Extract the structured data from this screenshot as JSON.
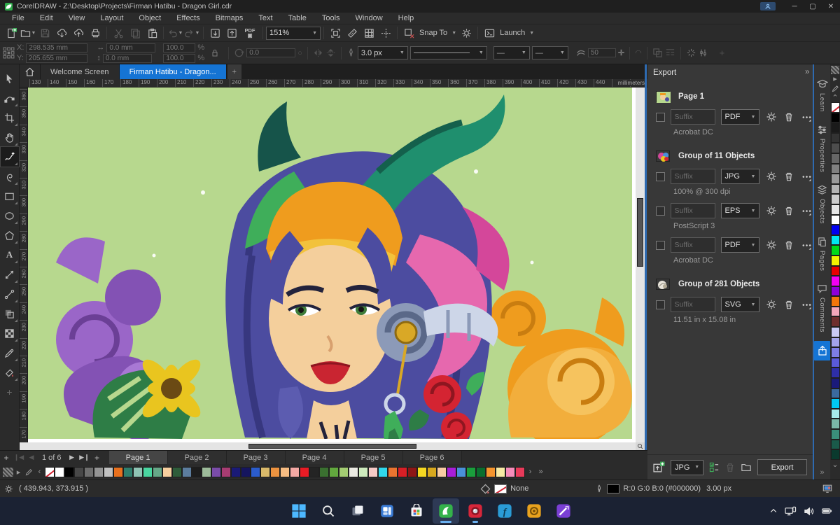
{
  "accent": "#1574d4",
  "titlebar": {
    "title": "CorelDRAW - Z:\\Desktop\\Projects\\Firman Hatibu - Dragon Girl.cdr"
  },
  "menubar": {
    "items": [
      "File",
      "Edit",
      "View",
      "Layout",
      "Object",
      "Effects",
      "Bitmaps",
      "Text",
      "Table",
      "Tools",
      "Window",
      "Help"
    ]
  },
  "toolbar": {
    "zoom_value": "151%",
    "snap_label": "Snap To",
    "launch_label": "Launch",
    "pdf_label": "PDF",
    "buttons": [
      {
        "name": "new-document",
        "icon": "newdoc"
      },
      {
        "name": "open",
        "icon": "open",
        "dd": true
      },
      {
        "name": "save",
        "icon": "save",
        "disabled": true
      },
      {
        "name": "cloud-download",
        "icon": "clouddown"
      },
      {
        "name": "cloud-upload",
        "icon": "cloudup"
      },
      {
        "name": "print",
        "icon": "print"
      },
      "|",
      {
        "name": "cut",
        "icon": "cut",
        "disabled": true
      },
      {
        "name": "copy",
        "icon": "copy",
        "disabled": true
      },
      {
        "name": "paste",
        "icon": "paste"
      },
      "|",
      {
        "name": "undo",
        "icon": "undo",
        "disabled": true,
        "dd": true
      },
      {
        "name": "redo",
        "icon": "redo",
        "disabled": true,
        "dd": true
      },
      "|",
      {
        "name": "import",
        "icon": "importic"
      },
      {
        "name": "export",
        "icon": "exportic"
      },
      {
        "name": "publish-to-pdf",
        "icon": "pdf"
      },
      "|",
      {
        "type": "zoom-select"
      },
      "|",
      {
        "name": "full-screen-preview",
        "icon": "fullscreen"
      },
      {
        "name": "show-rulers",
        "icon": "rulericon"
      },
      {
        "name": "show-grid",
        "icon": "grid"
      },
      {
        "name": "show-guidelines",
        "icon": "guides"
      },
      "|",
      {
        "name": "snap-off",
        "icon": "snapx"
      },
      {
        "type": "snap-select"
      },
      {
        "name": "options",
        "icon": "gear"
      },
      "|",
      {
        "type": "launch-select"
      }
    ]
  },
  "propertybar": {
    "x": "298.535 mm",
    "y": "205.655 mm",
    "width": "0.0 mm",
    "height": "0.0 mm",
    "scale_x": "100.0",
    "scale_y": "100.0",
    "angle": "0.0",
    "outline_width": "3.0 px",
    "corner_value": "50"
  },
  "doc_tabs": {
    "tabs": [
      {
        "label": "Welcome Screen",
        "active": false
      },
      {
        "label": "Firman Hatibu - Dragon...",
        "active": true
      }
    ]
  },
  "ruler": {
    "unit_label": "millimeters",
    "h_start": 130,
    "h_end": 460,
    "step": 10,
    "v_start": 360,
    "v_count": 20
  },
  "toolbox": {
    "tools": [
      {
        "name": "pick-tool",
        "icon": "pick"
      },
      {
        "name": "shape-tool",
        "icon": "shape",
        "flyout": true
      },
      {
        "name": "crop-tool",
        "icon": "crop",
        "flyout": true
      },
      {
        "name": "pan-tool",
        "icon": "pan",
        "flyout": true
      },
      {
        "name": "curve-tool",
        "icon": "freehand",
        "flyout": true,
        "selected": true
      },
      {
        "name": "artistic-media-tool",
        "icon": "spiral",
        "flyout": true
      },
      {
        "name": "rectangle-tool",
        "icon": "rectic",
        "flyout": true
      },
      {
        "name": "ellipse-tool",
        "icon": "ellipseic",
        "flyout": true
      },
      {
        "name": "polygon-tool",
        "icon": "polygonic",
        "flyout": true
      },
      {
        "name": "text-tool",
        "icon": "textic",
        "flyout": true
      },
      {
        "name": "dimension-tool",
        "icon": "dimension",
        "flyout": true
      },
      {
        "name": "connector-tool",
        "icon": "connector",
        "flyout": true
      },
      {
        "name": "drop-shadow-tool",
        "icon": "shadow",
        "flyout": true
      },
      {
        "name": "mesh-fill-tool",
        "icon": "checker",
        "flyout": true
      },
      {
        "name": "eyedropper-tool",
        "icon": "eyedropper",
        "flyout": true
      },
      {
        "name": "interactive-fill-tool",
        "icon": "fillic",
        "flyout": true
      },
      {
        "name": "customize-toolbox",
        "icon": "plusic",
        "plus": true
      }
    ]
  },
  "export_panel": {
    "title": "Export",
    "groups": [
      {
        "name": "Page 1",
        "thumb": "page",
        "rows": [
          {
            "suffix_placeholder": "Suffix",
            "format": "PDF",
            "caption": "Acrobat DC"
          }
        ]
      },
      {
        "name": "Group of 11 Objects",
        "thumb": "group1",
        "rows": [
          {
            "suffix_placeholder": "Suffix",
            "format": "JPG",
            "caption": "100% @ 300 dpi"
          },
          {
            "suffix_placeholder": "Suffix",
            "format": "EPS",
            "caption": "PostScript 3"
          },
          {
            "suffix_placeholder": "Suffix",
            "format": "PDF",
            "caption": "Acrobat DC"
          }
        ]
      },
      {
        "name": "Group of 281 Objects",
        "thumb": "group2",
        "rows": [
          {
            "suffix_placeholder": "Suffix",
            "format": "SVG",
            "caption": "11.51 in x 15.08 in"
          }
        ]
      }
    ],
    "footer": {
      "format": "JPG",
      "export_label": "Export"
    }
  },
  "docker_tabs": [
    {
      "label": "Learn",
      "icon": "learn"
    },
    {
      "label": "Properties",
      "icon": "props"
    },
    {
      "label": "Objects",
      "icon": "objectsic"
    },
    {
      "label": "Pages",
      "icon": "pagesic"
    },
    {
      "label": "Comments",
      "icon": "comments"
    },
    {
      "label": "",
      "icon": "exporttab",
      "active": true,
      "name": "export"
    }
  ],
  "pages_bar": {
    "counter": "1 of 6",
    "tabs": [
      "Page 1",
      "Page 2",
      "Page 3",
      "Page 4",
      "Page 5",
      "Page 6"
    ],
    "active_index": 0
  },
  "palette_bottom": [
    "none",
    "#ffffff",
    "#000000",
    "#474747",
    "#6e6e6e",
    "#949494",
    "#c0c0c0",
    "#e8701d",
    "#2f7f6d",
    "#8fc4b4",
    "#49d6a0",
    "#66a888",
    "#f7cf9f",
    "#2e5c3a",
    "#5c7d9e",
    "#1d1d1d",
    "#9dbb9a",
    "#7a4ca8",
    "#a83c72",
    "#1a1a77",
    "#15155e",
    "#2b5ccb",
    "#d9b96a",
    "#ec9340",
    "#f6bc82",
    "#f4a9a4",
    "#ea1c25",
    "#242424",
    "#3a7030",
    "#62a83e",
    "#a3cc72",
    "#ebeae2",
    "#cdeabc",
    "#f6cac6",
    "#31d7ea",
    "#ea7430",
    "#d81f26",
    "#8e1616",
    "#f5d721",
    "#d8a81e",
    "#f7cba3",
    "#a81ed8",
    "#4a90d9",
    "#1a9e3c",
    "#0a6e2e",
    "#f5952e",
    "#f7eaa5",
    "#f58cba",
    "#e83a5a"
  ],
  "palette_right": [
    "none",
    "#000000",
    "#1a1a1a",
    "#333333",
    "#4d4d4d",
    "#666666",
    "#808080",
    "#999999",
    "#b3b3b3",
    "#cccccc",
    "#e6e6e6",
    "#ffffff",
    "#0000f2",
    "#00e6f2",
    "#00d91a",
    "#f2f200",
    "#e60000",
    "#f200f2",
    "#8e00d9",
    "#f2760a",
    "#f2a6ba",
    "#6e2e2e",
    "#c9c9f4",
    "#a3a3ea",
    "#7e7ee6",
    "#5a5ad9",
    "#2e2ea8",
    "#1a1a7a",
    "#3a6a9e",
    "#00c9f2",
    "#a6eaea",
    "#7ab8a8",
    "#3a8e7a",
    "#1a5a4a",
    "#0a3a2e"
  ],
  "statusbar": {
    "cursor_coords": "( 439.943, 373.915 )",
    "fill_label": "None",
    "outline_info": "R:0 G:0 B:0 (#000000)",
    "outline_width": "3.00 px"
  },
  "taskbar": {
    "apps": [
      {
        "name": "start"
      },
      {
        "name": "search"
      },
      {
        "name": "task-view"
      },
      {
        "name": "widgets"
      },
      {
        "name": "microsoft-store"
      },
      {
        "name": "coreldraw",
        "active": true,
        "underline": 16
      },
      {
        "name": "photo-paint",
        "underline": 8
      },
      {
        "name": "font-manager"
      },
      {
        "name": "capture"
      },
      {
        "name": "corel-connect"
      }
    ]
  }
}
